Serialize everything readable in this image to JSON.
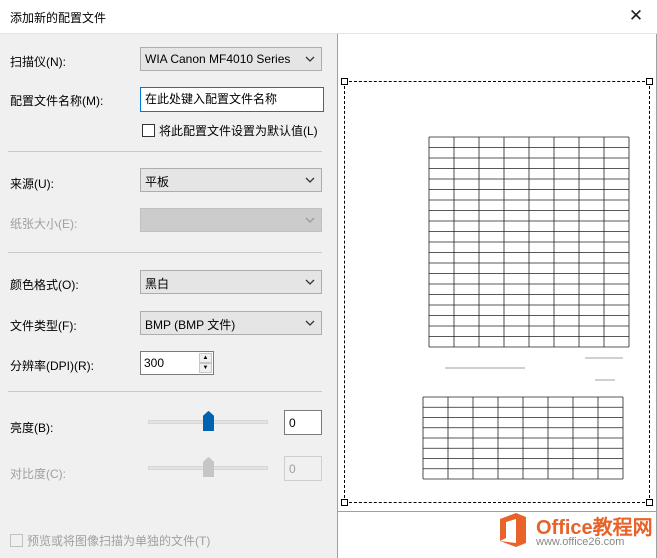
{
  "window": {
    "title": "添加新的配置文件"
  },
  "form": {
    "scanner": {
      "label": "扫描仪(N):",
      "value": "WIA Canon MF4010 Series"
    },
    "profile_name": {
      "label": "配置文件名称(M):",
      "value": "在此处键入配置文件名称"
    },
    "set_default": {
      "label": "将此配置文件设置为默认值(L)",
      "checked": false
    },
    "source": {
      "label": "来源(U):",
      "value": "平板"
    },
    "paper_size": {
      "label": "纸张大小(E):",
      "value": "",
      "disabled": true
    },
    "color_format": {
      "label": "颜色格式(O):",
      "value": "黑白"
    },
    "file_type": {
      "label": "文件类型(F):",
      "value": "BMP (BMP 文件)"
    },
    "resolution": {
      "label": "分辨率(DPI)(R):",
      "value": "300"
    },
    "brightness": {
      "label": "亮度(B):",
      "value": "0",
      "level": 0.5
    },
    "contrast": {
      "label": "对比度(C):",
      "value": "0",
      "level": 0.5,
      "disabled": true
    },
    "preview_separate": {
      "label": "预览或将图像扫描为单独的文件(T)",
      "checked": false,
      "disabled": true
    }
  },
  "watermark": {
    "title": "Office教程网",
    "url": "www.office26.com"
  },
  "icons": {
    "close": "close-icon",
    "dropdown": "chevron-down-icon",
    "office": "office-logo-icon"
  },
  "colors": {
    "accent_border": "#0078d7",
    "slider_thumb": "#0063b1",
    "watermark_orange": "#e8622a"
  }
}
